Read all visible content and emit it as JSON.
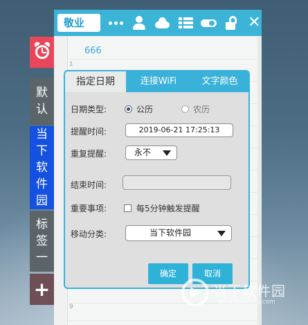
{
  "toolbar": {
    "title": "敬业签",
    "icons": [
      "more-icon",
      "user-icon",
      "cloud-icon",
      "list-icon",
      "toggle-icon",
      "unlock-icon",
      "close-icon"
    ],
    "close_glyph": "✕"
  },
  "sidebar": {
    "tabs": [
      {
        "name": "alarm",
        "icon": "alarm-clock-icon",
        "color": "#e9465b"
      },
      {
        "name": "默认",
        "chars": [
          "默",
          "认"
        ],
        "color": "#5b6468"
      },
      {
        "name": "当下软件园",
        "chars": [
          "当",
          "下",
          "软",
          "件",
          "园"
        ],
        "color": "#1451e0"
      },
      {
        "name": "标签一",
        "chars": [
          "标",
          "签",
          "一"
        ],
        "color": "#5b6468"
      },
      {
        "name": "add",
        "glyph": "+",
        "color": "#6d4f55"
      }
    ]
  },
  "note": {
    "text": "666",
    "line_numbers": [
      "1",
      "9"
    ]
  },
  "dialog": {
    "tabs": [
      {
        "label": "指定日期",
        "active": true
      },
      {
        "label": "连接WiFi",
        "active": false
      },
      {
        "label": "文字颜色",
        "active": false
      }
    ],
    "date_type_label": "日期类型:",
    "date_type_options": [
      {
        "label": "公历",
        "selected": true
      },
      {
        "label": "农历",
        "selected": false
      }
    ],
    "remind_time_label": "提醒时间:",
    "remind_time_value": "2019-06-21 17:25:13",
    "repeat_label": "重复提醒:",
    "repeat_value": "永不",
    "end_time_label": "结束时间:",
    "end_time_value": "",
    "important_label": "重要事项:",
    "important_option": "每5分钟触发提醒",
    "important_checked": false,
    "move_label": "移动分类:",
    "move_value": "当下软件园",
    "confirm": "确定",
    "cancel": "取消"
  },
  "watermark": {
    "text": "当下软件园",
    "url": "www.downxia.com"
  },
  "colors": {
    "accent": "#3bb4d8",
    "dialog_bg": "#dfdfdf",
    "note_text": "#3aa3d3"
  }
}
